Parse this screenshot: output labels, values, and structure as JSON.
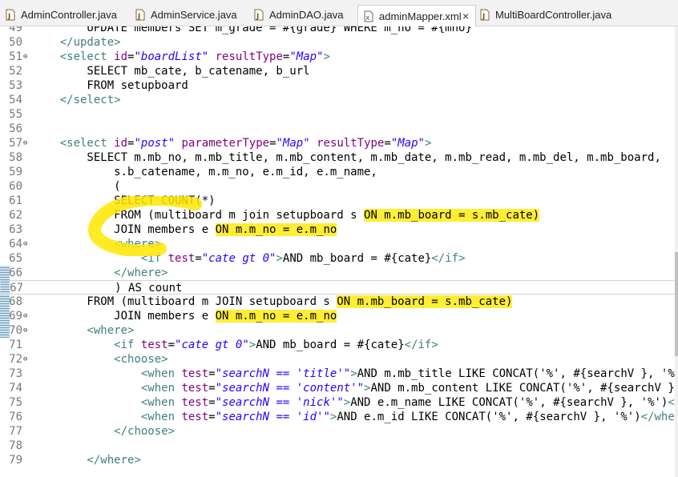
{
  "tabs": [
    {
      "label": "AdminController.java",
      "icon": "java-file-icon",
      "active": false
    },
    {
      "label": "AdminService.java",
      "icon": "java-file-icon",
      "active": false
    },
    {
      "label": "AdminDAO.java",
      "icon": "java-file-icon",
      "active": false
    },
    {
      "label": "adminMapper.xml",
      "icon": "xml-file-icon",
      "active": true,
      "close": "×"
    },
    {
      "label": "MultiBoardController.java",
      "icon": "java-file-icon",
      "active": false
    }
  ],
  "colors": {
    "tag": "#3f7f7f",
    "attribute": "#7f007f",
    "value": "#2a00ff",
    "line_number": "#787878",
    "highlight": "#ffee33"
  },
  "lines": [
    {
      "n": "49",
      "code": "UPDATE members SET m_grade = #{grade} WHERE m_no = #{mno}",
      "indent": "        "
    },
    {
      "n": "50",
      "code": "</update>",
      "indent": "    "
    },
    {
      "n": "50",
      "code": "",
      "indent": ""
    },
    {
      "n": "51",
      "code": "<select id=\"boardList\" resultType=\"Map\">",
      "indent": "    ",
      "fold": "⊖"
    },
    {
      "n": "52",
      "code": "SELECT mb_cate, b_catename, b_url",
      "indent": "        "
    },
    {
      "n": "53",
      "code": "FROM setupboard",
      "indent": "        "
    },
    {
      "n": "54",
      "code": "</select>",
      "indent": "    "
    },
    {
      "n": "55",
      "code": "",
      "indent": ""
    },
    {
      "n": "56",
      "code": "",
      "indent": ""
    },
    {
      "n": "57",
      "code": "<select id=\"post\" parameterType=\"Map\" resultType=\"Map\">",
      "indent": "    ",
      "fold": "⊖"
    },
    {
      "n": "58",
      "code": "SELECT m.mb_no, m.mb_title, m.mb_content, m.mb_date, m.mb_read, m.mb_del, m.mb_board,",
      "indent": "        "
    },
    {
      "n": "59",
      "code": "s.b_catename, m.m_no, e.m_id, e.m_name,",
      "indent": "            "
    },
    {
      "n": "60",
      "code": "(",
      "indent": "            "
    },
    {
      "n": "61",
      "code": "SELECT COUNT(*)",
      "indent": "            "
    },
    {
      "n": "62",
      "code": "FROM (multiboard m join setupboard s ON m.mb_board = s.mb_cate)",
      "indent": "            "
    },
    {
      "n": "63",
      "code": "JOIN members e ON m.m_no = e.m_no",
      "indent": "            "
    },
    {
      "n": "64",
      "code": "<where>",
      "indent": "            ",
      "fold": "⊖"
    },
    {
      "n": "65",
      "code": "<if test=\"cate gt 0\">AND mb_board = #{cate}</if>",
      "indent": "                "
    },
    {
      "n": "66",
      "code": "</where>",
      "indent": "            "
    },
    {
      "n": "67",
      "code": ") AS count",
      "indent": "            "
    },
    {
      "n": "68",
      "code": "FROM (multiboard m JOIN setupboard s ON m.mb_board = s.mb_cate)",
      "indent": "        "
    },
    {
      "n": "69",
      "code": "JOIN members e ON m.m_no = e.m_no",
      "indent": "            ",
      "fold": "⊖"
    },
    {
      "n": "70",
      "code": "<where>",
      "indent": "        ",
      "fold": "⊖"
    },
    {
      "n": "71",
      "code": "<if test=\"cate gt 0\">AND mb_board = #{cate}</if>",
      "indent": "            "
    },
    {
      "n": "72",
      "code": "<choose>",
      "indent": "            ",
      "fold": "⊖"
    },
    {
      "n": "73",
      "code": "<when test=\"searchN == 'title'\">AND m.mb_title LIKE CONCAT('%', #{searchV }, '%')</w",
      "indent": "                "
    },
    {
      "n": "74",
      "code": "<when test=\"searchN == 'content'\">AND m.mb_content LIKE CONCAT('%', #{searchV }, '%'",
      "indent": "                "
    },
    {
      "n": "75",
      "code": "<when test=\"searchN == 'nick'\">AND e.m_name LIKE CONCAT('%', #{searchV }, '%')</when",
      "indent": "                "
    },
    {
      "n": "76",
      "code": "<when test=\"searchN == 'id'\">AND e.m_id LIKE CONCAT('%', #{searchV }, '%')</when>",
      "indent": "                "
    },
    {
      "n": "77",
      "code": "</choose>",
      "indent": "            "
    },
    {
      "n": "78",
      "code": "",
      "indent": ""
    },
    {
      "n": "79",
      "code": "</where>",
      "indent": "        "
    }
  ],
  "highlights": [
    "ON m.mb_board = s.mb_cate)",
    "ON m.m_no = e.m_no"
  ]
}
